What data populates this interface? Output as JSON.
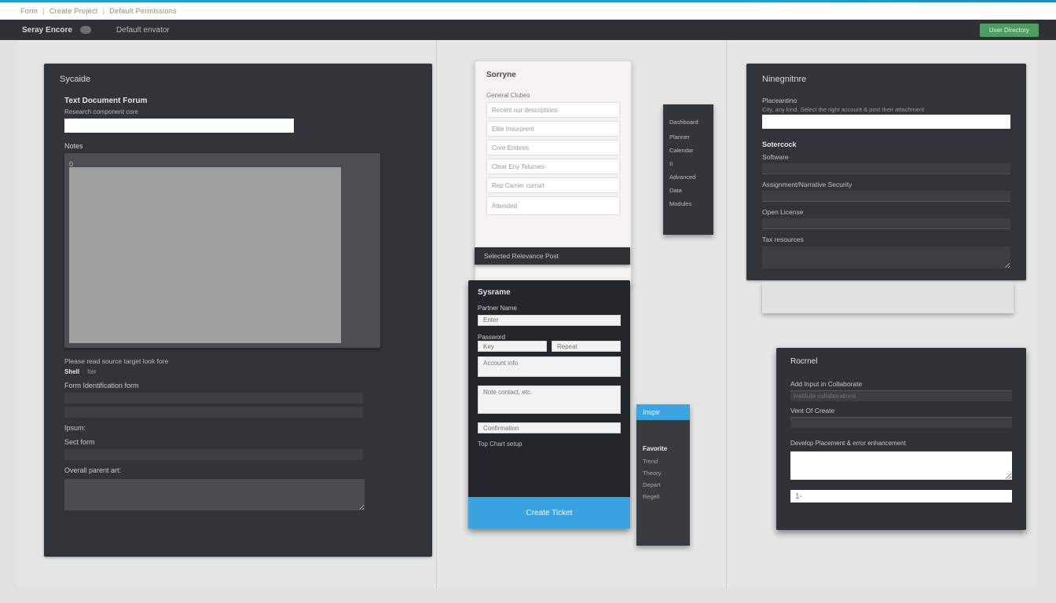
{
  "breadcrumbs": {
    "a": "Form",
    "b": "Create Project",
    "c": "Default Permissions"
  },
  "header": {
    "brand": "Seray Encore",
    "nav1": "Default envator",
    "cta": "User Directory"
  },
  "sycale": {
    "title": "Sycaide",
    "section": "Text Document Forum",
    "field1_label": "Research component core",
    "notes_label": "Notes",
    "ta_value": "0",
    "caption": "Please read source target look fore",
    "tabs": {
      "a": "Shell",
      "b": "Iter"
    },
    "range_label": "Form Identification form",
    "ipsum_label": "Ipsum:",
    "sect_label": "Sect  form",
    "overall_label": "Overall parent art:"
  },
  "sorryne": {
    "title": "Sorryne",
    "subtitle": "General Clubes",
    "items": [
      "Recent our descriptions",
      "Elite Insurprent",
      "Core Embres",
      "Clear Eny Telumes",
      "Rep Carrier currurt"
    ],
    "long": "Attended",
    "bar": "Selected Relevance Post"
  },
  "sysrame": {
    "title": "Sysrame",
    "lbl_partner": "Partner Name",
    "ph_partner": "Enter",
    "lbl_pw": "Password",
    "ph_pw_a": "Key",
    "ph_pw_b": "Repeat",
    "ph_pw_text": "Account info",
    "ph_msg": "Note contact, etc.",
    "ph_confirm": "Confirmation",
    "link": "Top Chart setup",
    "cta": "Create Ticket"
  },
  "nav1": {
    "items": [
      "Dashboard",
      "Planner",
      "Calendar",
      "II",
      "Advanced",
      "Data",
      "Modules"
    ]
  },
  "nav2": {
    "header": "Inspir",
    "section": "Favorite",
    "items": [
      "Trend",
      "Theory",
      "Depart",
      "Regell"
    ]
  },
  "nine": {
    "title": "Ninegnitnre",
    "lbl1": "Placeantino",
    "hint": "City, any kind. Select the right account & post their attachment",
    "sect": "Sotercock",
    "lbl_soft": "Software",
    "lbl_assign": "Assignment/Narrative Security",
    "lbl_open": "Open License",
    "lbl_tax": "Tax resources"
  },
  "roc": {
    "title": "Rocrnel",
    "lbl1": "Add Input in Collaborate",
    "ph1": "Institute collaborations",
    "lbl2": "Vent Of Create",
    "desc": "Develop Placement & error enhancement",
    "ph_small": "1-"
  }
}
